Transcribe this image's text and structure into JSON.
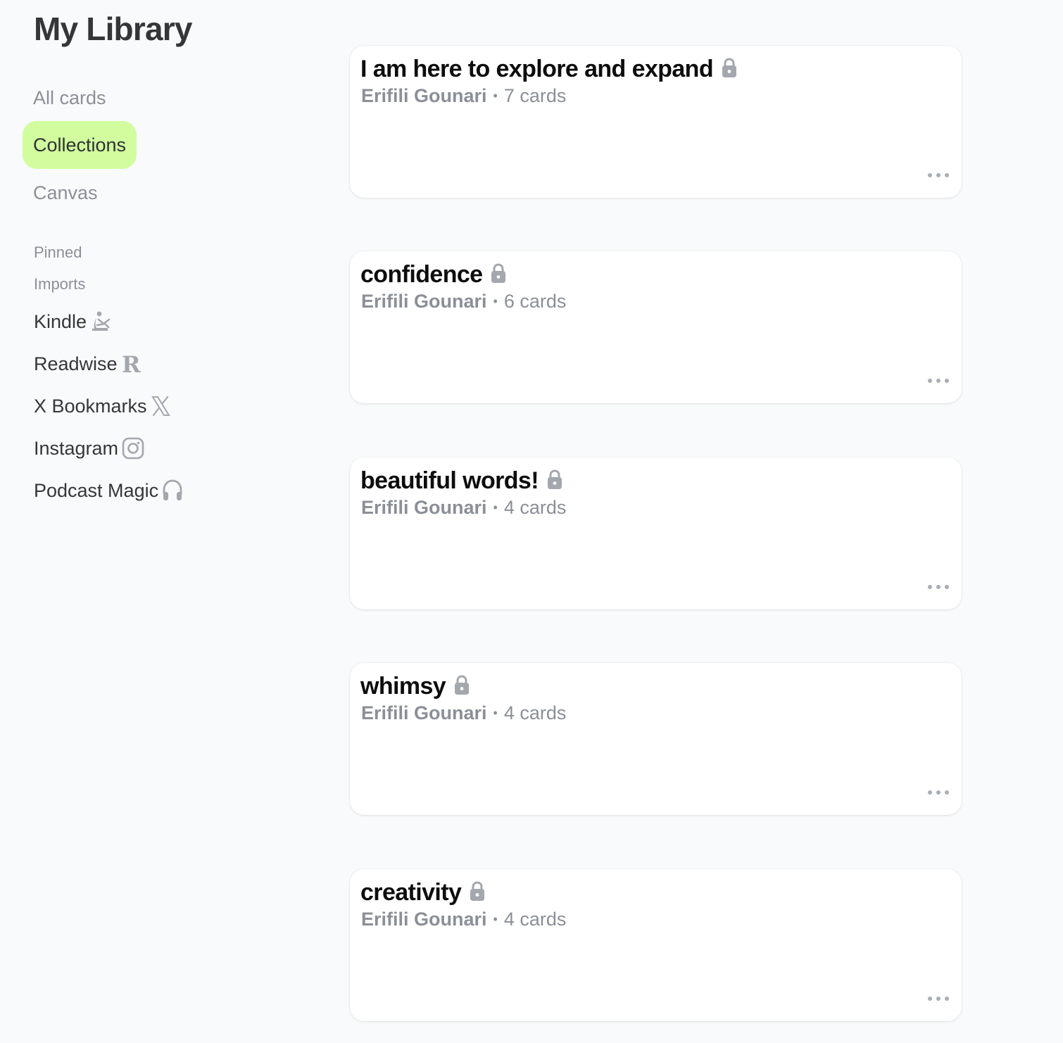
{
  "sidebar": {
    "title": "My Library",
    "nav": [
      {
        "label": "All cards",
        "active": false
      },
      {
        "label": "Collections",
        "active": true
      },
      {
        "label": "Canvas",
        "active": false
      }
    ],
    "pinned_label": "Pinned",
    "imports_label": "Imports",
    "imports": [
      {
        "label": "Kindle",
        "icon": "kindle-reader-icon"
      },
      {
        "label": "Readwise",
        "icon": "readwise-r-icon"
      },
      {
        "label": "X Bookmarks",
        "icon": "x-logo-icon"
      },
      {
        "label": "Instagram",
        "icon": "instagram-icon"
      },
      {
        "label": "Podcast Magic",
        "icon": "headphones-icon"
      }
    ]
  },
  "collections": [
    {
      "title": "I am here to explore and expand",
      "author": "Erifili Gounari",
      "separator": "•",
      "count": "7 cards",
      "locked": true
    },
    {
      "title": "confidence",
      "author": "Erifili Gounari",
      "separator": "•",
      "count": "6 cards",
      "locked": true
    },
    {
      "title": "beautiful words!",
      "author": "Erifili Gounari",
      "separator": "•",
      "count": "4 cards",
      "locked": true
    },
    {
      "title": "whimsy",
      "author": "Erifili Gounari",
      "separator": "•",
      "count": "4 cards",
      "locked": true
    },
    {
      "title": "creativity",
      "author": "Erifili Gounari",
      "separator": "•",
      "count": "4 cards",
      "locked": true
    }
  ],
  "colors": {
    "background": "#f9fafb",
    "active_nav": "#d1fd9f",
    "muted_text": "#8b8f97",
    "icon_gray": "#a3a7ae"
  }
}
